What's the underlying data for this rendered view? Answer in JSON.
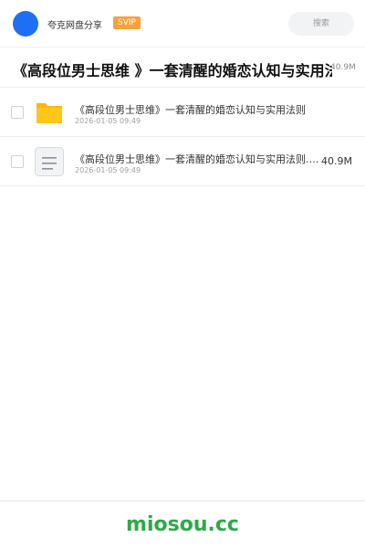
{
  "header": {
    "user_name": "夸克网盘分享",
    "badge": "SVIP",
    "search_label": "搜索"
  },
  "share": {
    "title": "《高段位男士思维 》一套清醒的婚恋认知与实用法则",
    "total_size": "40.9M"
  },
  "files": [
    {
      "name": "《高段位男士思维》一套清醒的婚恋认知与实用法则",
      "date": "2026-01-05 09:49",
      "size": "",
      "icon": "folder-icon"
    },
    {
      "name": "《高段位男士思维》一套清醒的婚恋认知与实用法则.pdf",
      "date": "2026-01-05 09:49",
      "size": "40.9M",
      "icon": "document-icon"
    }
  ],
  "footer": {
    "brand": "miosou.cc"
  },
  "colors": {
    "avatar": "#1e6ff3",
    "svip_badge": "#f5a13c",
    "brand": "#2ea84a",
    "folder": "#ffc61b"
  }
}
